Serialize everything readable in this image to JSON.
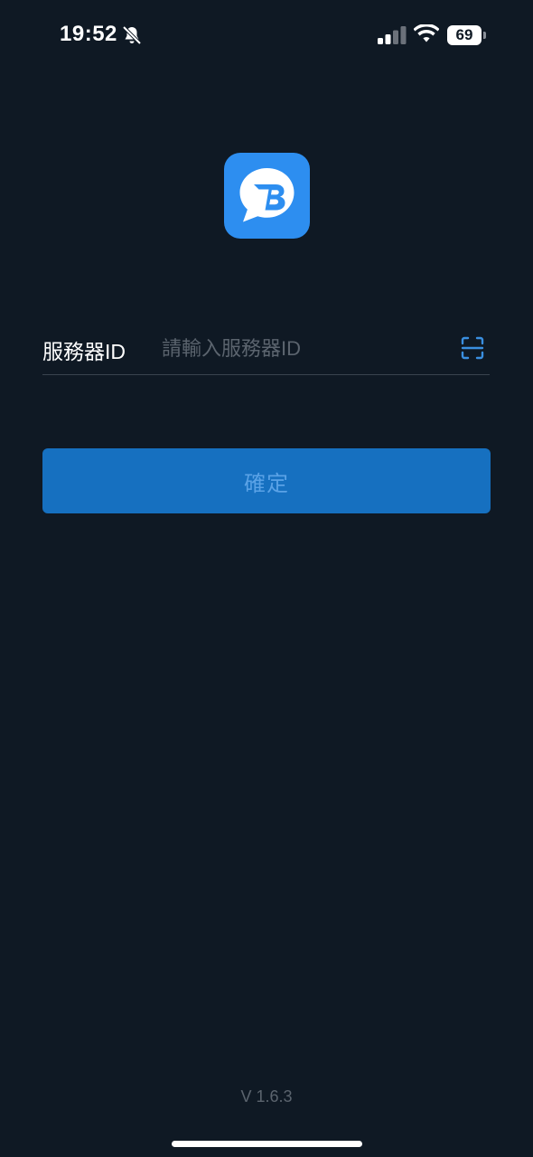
{
  "status_bar": {
    "time": "19:52",
    "battery_level": "69",
    "icons": [
      "mute-bell-icon",
      "cellular-signal-icon",
      "wifi-icon",
      "battery-icon"
    ]
  },
  "logo": {
    "icon": "chat-bubble-b-logo",
    "color": "#2d8ef0"
  },
  "form": {
    "server_label": "服務器ID",
    "server_value": "",
    "server_placeholder": "請輸入服務器ID",
    "scan_icon": "scan-icon",
    "confirm_label": "確定"
  },
  "footer": {
    "version": "V 1.6.3"
  },
  "colors": {
    "background": "#0f1924",
    "accent": "#1670c0",
    "accent_text": "#5aa2e6",
    "muted_text": "#5b646e"
  }
}
